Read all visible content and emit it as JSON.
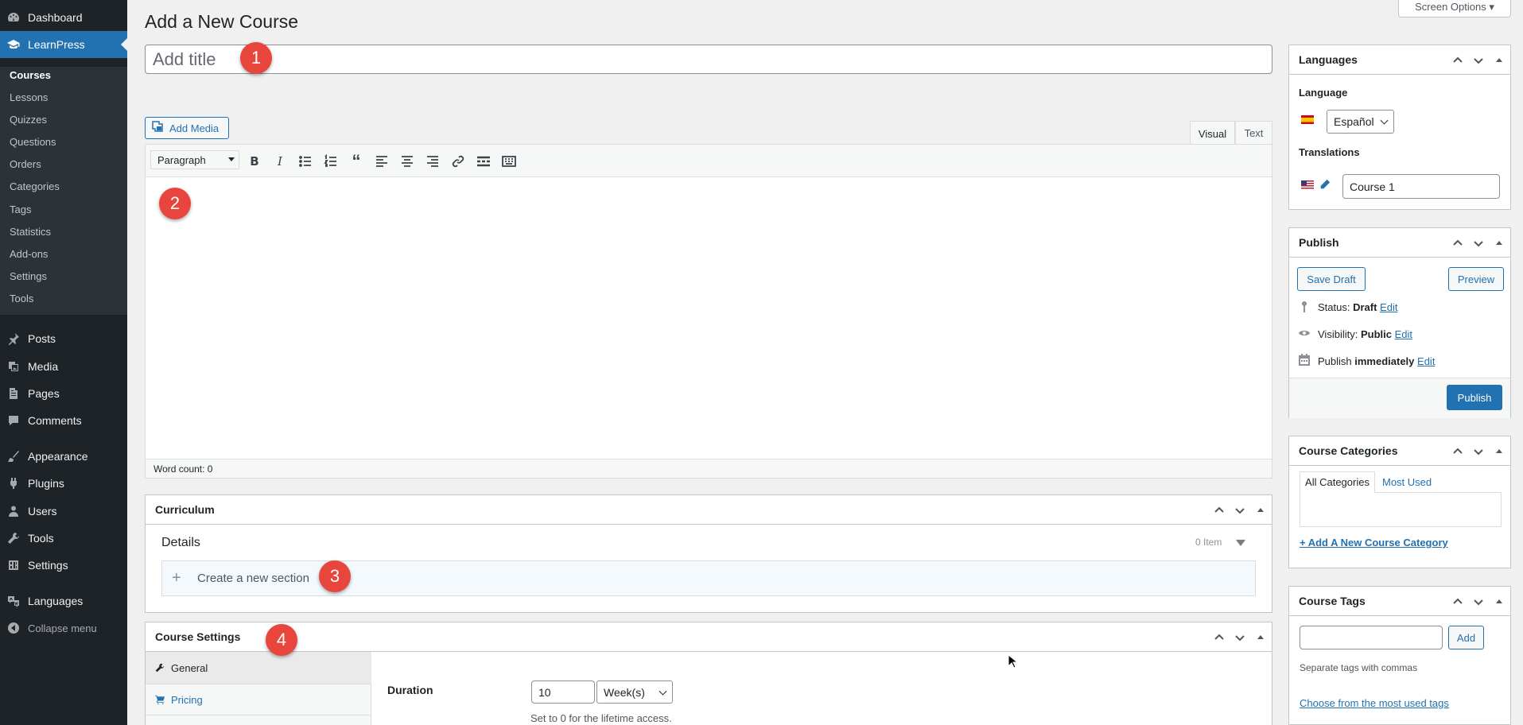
{
  "sidebar": {
    "items": [
      {
        "label": "Dashboard",
        "icon": "dashboard-icon"
      },
      {
        "label": "LearnPress",
        "icon": "learnpress-icon"
      },
      {
        "label": "Posts",
        "icon": "pin-icon"
      },
      {
        "label": "Media",
        "icon": "media-icon"
      },
      {
        "label": "Pages",
        "icon": "pages-icon"
      },
      {
        "label": "Comments",
        "icon": "comment-icon"
      },
      {
        "label": "Appearance",
        "icon": "paintbrush-icon"
      },
      {
        "label": "Plugins",
        "icon": "plugin-icon"
      },
      {
        "label": "Users",
        "icon": "user-icon"
      },
      {
        "label": "Tools",
        "icon": "wrench-icon"
      },
      {
        "label": "Settings",
        "icon": "settings-icon"
      },
      {
        "label": "Languages",
        "icon": "translation-icon"
      }
    ],
    "submenu": [
      "Courses",
      "Lessons",
      "Quizzes",
      "Questions",
      "Orders",
      "Categories",
      "Tags",
      "Statistics",
      "Add-ons",
      "Settings",
      "Tools"
    ],
    "collapse_label": "Collapse menu",
    "accent": "#2271b1"
  },
  "header": {
    "title": "Add a New Course",
    "screen_options": "Screen Options ▾"
  },
  "editor": {
    "title_placeholder": "Add title",
    "add_media": "Add Media",
    "tab_visual": "Visual",
    "tab_text": "Text",
    "format": "Paragraph",
    "word_count": "Word count: 0"
  },
  "badges": [
    "1",
    "2",
    "3",
    "4"
  ],
  "curriculum": {
    "title": "Curriculum",
    "details": "Details",
    "item_count": "0 Item",
    "create_section": "Create a new section"
  },
  "course_settings": {
    "title": "Course Settings",
    "tabs": [
      "General",
      "Pricing"
    ],
    "duration_label": "Duration",
    "duration_value": "10",
    "duration_unit": "Week(s)",
    "duration_hint": "Set to 0 for the lifetime access."
  },
  "languages_box": {
    "title": "Languages",
    "language_label": "Language",
    "language_value": "Español",
    "translations_label": "Translations",
    "translation_value": "Course 1"
  },
  "publish_box": {
    "title": "Publish",
    "save_draft": "Save Draft",
    "preview": "Preview",
    "status_label": "Status: ",
    "status_value": "Draft",
    "visibility_label": "Visibility: ",
    "visibility_value": "Public",
    "publish_label": "Publish ",
    "publish_value": "immediately",
    "edit": "Edit",
    "publish_button": "Publish"
  },
  "categories_box": {
    "title": "Course Categories",
    "tab_all": "All Categories",
    "tab_most_used": "Most Used",
    "add_new": "+ Add A New Course Category"
  },
  "tags_box": {
    "title": "Course Tags",
    "add": "Add",
    "hint": "Separate tags with commas",
    "choose": "Choose from the most used tags"
  }
}
